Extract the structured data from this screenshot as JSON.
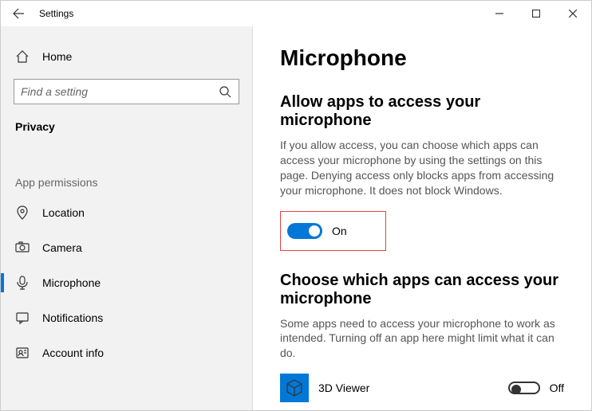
{
  "titlebar": {
    "title": "Settings"
  },
  "sidebar": {
    "home": "Home",
    "search_placeholder": "Find a setting",
    "category": "Privacy",
    "section": "App permissions",
    "items": [
      {
        "label": "Location"
      },
      {
        "label": "Camera"
      },
      {
        "label": "Microphone"
      },
      {
        "label": "Notifications"
      },
      {
        "label": "Account info"
      }
    ]
  },
  "main": {
    "heading": "Microphone",
    "section1_title": "Allow apps to access your microphone",
    "section1_desc": "If you allow access, you can choose which apps can access your microphone by using the settings on this page. Denying access only blocks apps from accessing your microphone. It does not block Windows.",
    "toggle1_state": "On",
    "section2_title": "Choose which apps can access your microphone",
    "section2_desc": "Some apps need to access your microphone to work as intended. Turning off an app here might limit what it can do.",
    "apps": [
      {
        "name": "3D Viewer",
        "state": "Off"
      }
    ]
  }
}
